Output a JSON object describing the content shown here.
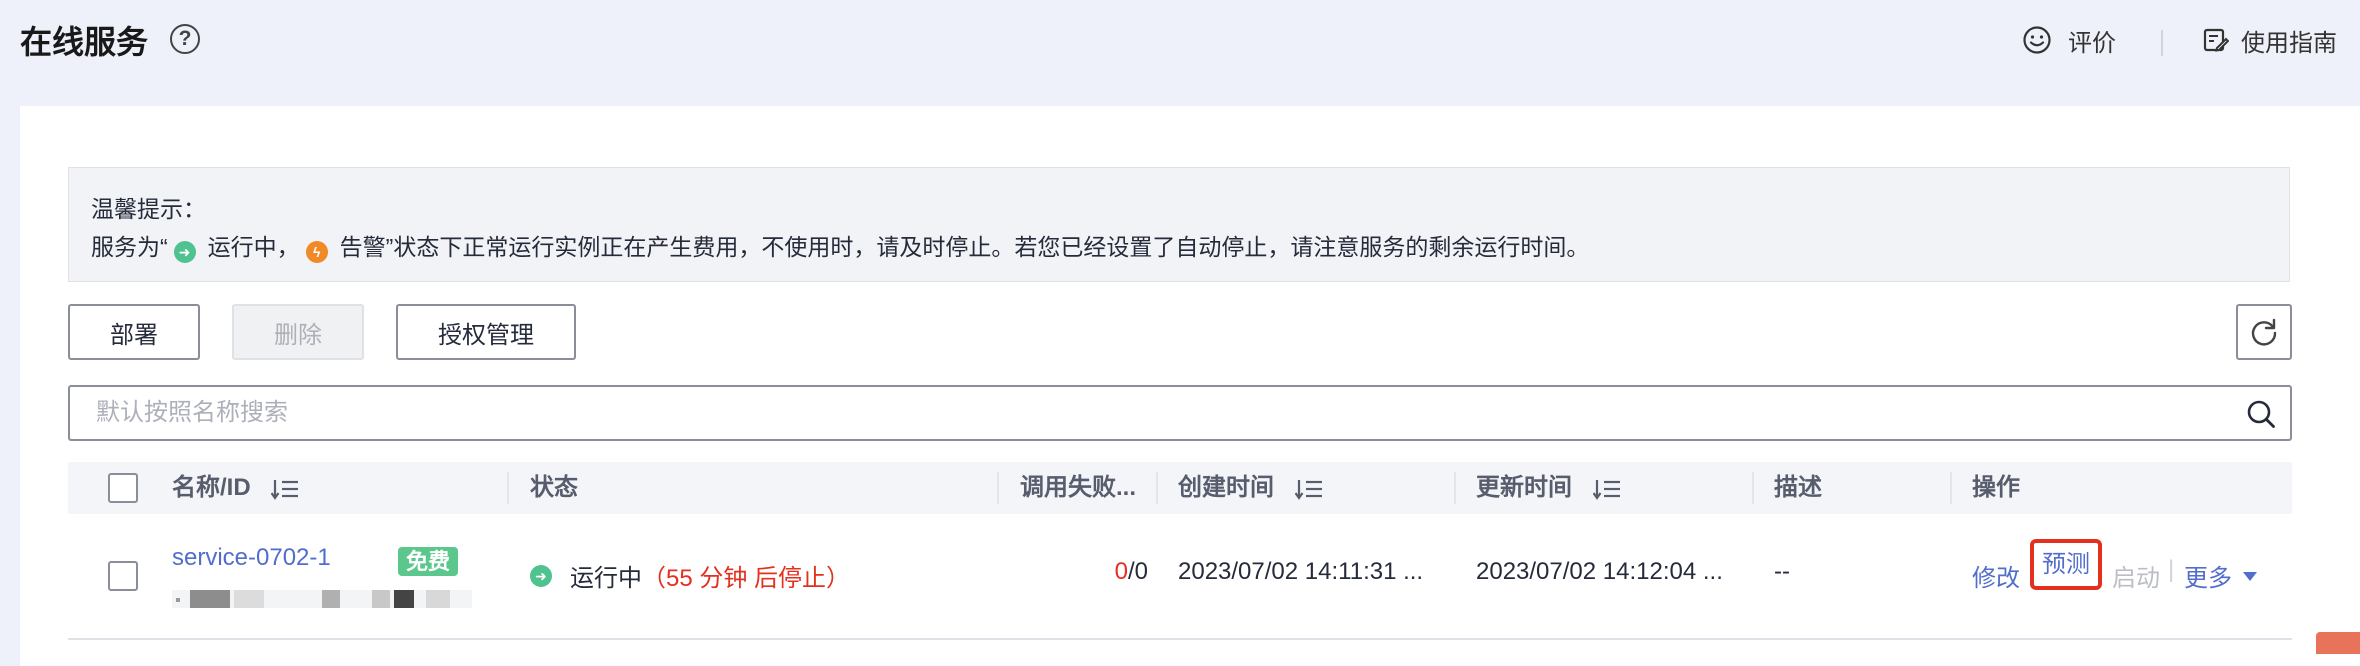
{
  "page": {
    "title": "在线服务",
    "rate_label": "评价",
    "guide_label": "使用指南"
  },
  "tip": {
    "heading": "温馨提示：",
    "part1": "服务为“",
    "status_running": "运行中，",
    "status_alarm": "告警",
    "part2": "”状态下正常运行实例正在产生费用，不使用时，请及时停止。若您已经设置了自动停止，请注意服务的剩余运行时间。"
  },
  "toolbar": {
    "deploy_label": "部署",
    "delete_label": "删除",
    "auth_label": "授权管理"
  },
  "search": {
    "placeholder": "默认按照名称搜索"
  },
  "table": {
    "columns": {
      "name": "名称/ID",
      "status": "状态",
      "failures": "调用失败...",
      "created": "创建时间",
      "updated": "更新时间",
      "desc": "描述",
      "ops": "操作"
    },
    "rows": [
      {
        "name": "service-0702-1",
        "badge": "免费",
        "status": "运行中",
        "status_note": "（55 分钟 后停止）",
        "fail_count": "0",
        "fail_total": "/0",
        "created": "2023/07/02 14:11:31 ...",
        "updated": "2023/07/02 14:12:04 ...",
        "desc": "--",
        "ops": {
          "edit": "修改",
          "predict": "预测",
          "start": "启动",
          "divider": "|",
          "more": "更多"
        }
      }
    ]
  },
  "colors": {
    "accent_link": "#526ecc",
    "running_green": "#50c28f",
    "alarm_orange": "#f08a27",
    "error_red": "#e3301f",
    "badge_green": "#5cc78c"
  }
}
